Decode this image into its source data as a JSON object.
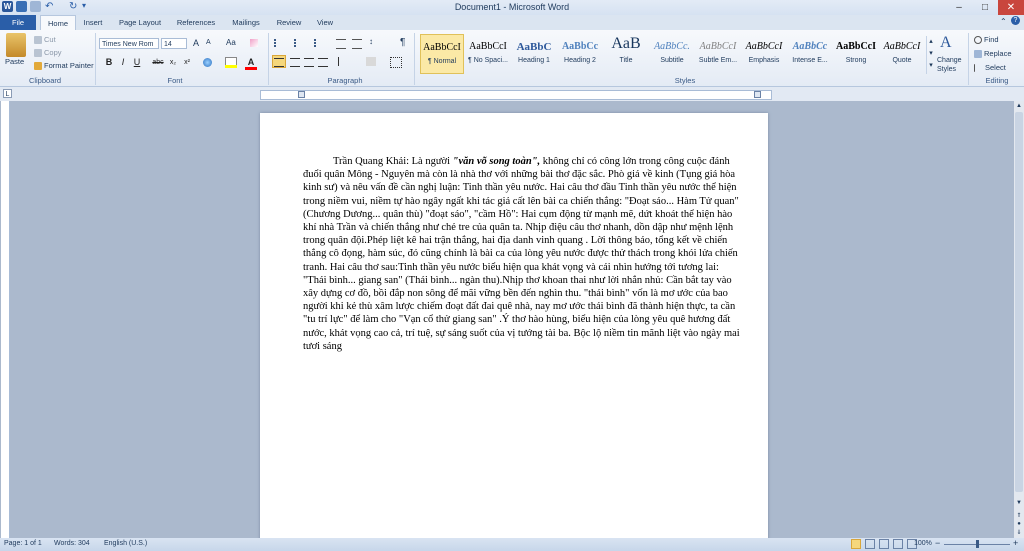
{
  "window": {
    "title": "Document1 - Microsoft Word",
    "controls": {
      "minimize": "–",
      "maximize": "□",
      "close": "✕"
    }
  },
  "tabs": [
    "File",
    "Home",
    "Insert",
    "Page Layout",
    "References",
    "Mailings",
    "Review",
    "View"
  ],
  "clipboard": {
    "paste": "Paste",
    "cut": "Cut",
    "copy": "Copy",
    "format_painter": "Format Painter",
    "label": "Clipboard"
  },
  "font": {
    "family": "Times New Rom",
    "size": "14",
    "label": "Font",
    "grow": "A",
    "shrink": "A",
    "case": "Aa",
    "bold": "B",
    "italic": "I",
    "underline": "U",
    "strike": "abc",
    "subscript": "x₂",
    "superscript": "x²",
    "font_color": "A"
  },
  "paragraph": {
    "label": "Paragraph",
    "show_marks": "¶"
  },
  "styles": {
    "label": "Styles",
    "change_styles": "Change Styles",
    "items": [
      {
        "sample": "AaBbCcI",
        "name": "¶ Normal"
      },
      {
        "sample": "AaBbCcI",
        "name": "¶ No Spaci..."
      },
      {
        "sample": "AaBbC",
        "name": "Heading 1"
      },
      {
        "sample": "AaBbCc",
        "name": "Heading 2"
      },
      {
        "sample": "AaB",
        "name": "Title"
      },
      {
        "sample": "AaBbCc.",
        "name": "Subtitle"
      },
      {
        "sample": "AaBbCcI",
        "name": "Subtle Em..."
      },
      {
        "sample": "AaBbCcI",
        "name": "Emphasis"
      },
      {
        "sample": "AaBbCc",
        "name": "Intense E..."
      },
      {
        "sample": "AaBbCcI",
        "name": "Strong"
      },
      {
        "sample": "AaBbCcI",
        "name": "Quote"
      }
    ]
  },
  "editing": {
    "find": "Find",
    "replace": "Replace",
    "select": "Select",
    "label": "Editing"
  },
  "document": {
    "p_before_bold": "Trần Quang Khải: Là người ",
    "p_bold": "\"văn võ song toàn\",",
    "p_after_bold": " không chỉ có công lớn trong công cuộc đánh đuổi quân Mông - Nguyên mà còn là nhà thơ với những bài thơ đặc sắc. Phò giá về kinh (Tụng giá hòa kinh sư) và nêu vấn đề cần nghị luận: Tinh thần yêu nước. Hai câu thơ đầu Tinh thần yêu nước thể hiện trong niềm vui, niềm tự hào ngây ngất khi tác giả cất lên bài ca chiến thắng: \"Đoạt sáo... Hàm Tử quan\" (Chương Dương... quân thù) \"đoạt sáo\", \"cầm Hồ\": Hai cụm động từ mạnh mẽ, dứt khoát thể hiện hào khí nhà Trần và chiến thắng như chẻ tre của quân ta. Nhịp điệu câu thơ nhanh, dồn dập như mệnh lệnh trong quân đội.Phép liệt kê hai trận thắng, hai địa danh vinh quang . Lời thông báo, tổng kết về chiến thắng cô đọng, hàm súc, đó cũng chính là bài ca của lòng yêu nước được thử thách trong khói lửa chiến tranh. Hai câu thơ sau:Tinh thần yêu nước biểu hiện qua khát vọng và cái nhìn hướng tới tương lai: \"Thái bình... giang san\" (Thái bình... ngàn thu).Nhịp thơ khoan thai như lời nhắn nhủ: Cần bắt tay vào xây dựng cơ đồ, bồi đắp non sông để mãi vững bền đến nghìn thu. \"thái bình\" vốn là mơ ước của bao người khi kẻ thù xâm lược chiếm đoạt đất đai quê nhà, nay mơ ước thái bình đã thành hiện thực, ta cần \"tu trí lực\" để làm cho \"Vạn cổ thử giang san\" .Ý thơ hào hùng, biểu hiện của lòng yêu quê hương đất nước, khát vọng cao cả, trí tuệ, sự sáng suốt của vị tướng tài ba. Bộc lộ niềm tin mãnh liệt vào ngày mai tươi sáng"
  },
  "status": {
    "page": "Page: 1 of 1",
    "words": "Words: 304",
    "language": "English (U.S.)",
    "zoom": "100%"
  },
  "colors": {
    "file_tab": "#2a5ea8",
    "ribbon": "#e4ebf5",
    "doc_bg": "#abb9cd",
    "highlight": "#ffff00",
    "font_color": "#ff0000"
  }
}
